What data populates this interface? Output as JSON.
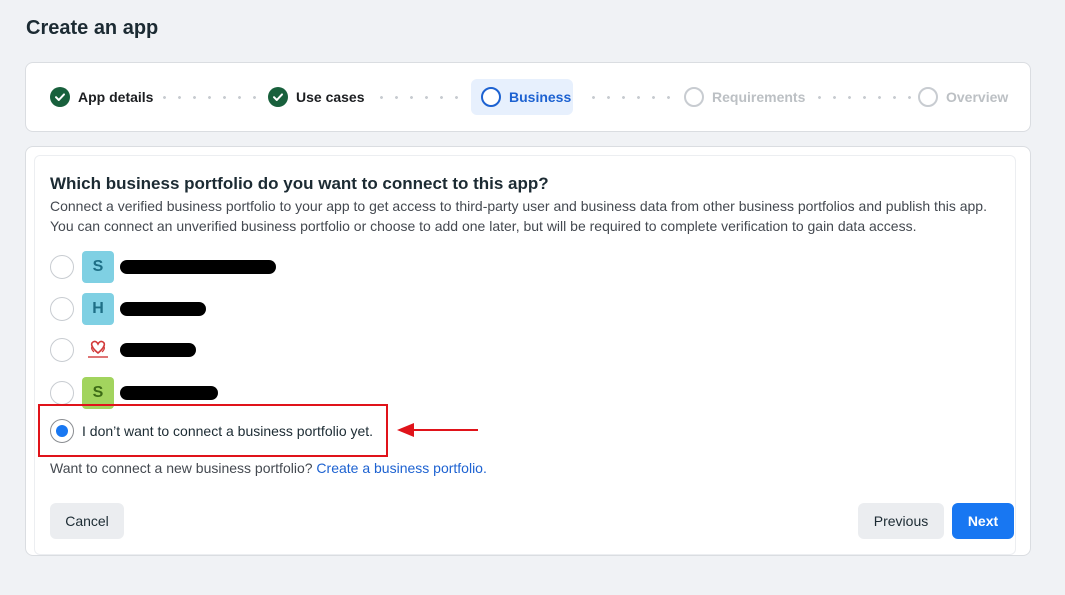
{
  "page": {
    "title": "Create an app"
  },
  "stepper": {
    "steps": [
      {
        "label": "App details",
        "state": "done"
      },
      {
        "label": "Use cases",
        "state": "done"
      },
      {
        "label": "Business",
        "state": "current"
      },
      {
        "label": "Requirements",
        "state": "pending"
      },
      {
        "label": "Overview",
        "state": "pending"
      }
    ]
  },
  "business": {
    "question": "Which business portfolio do you want to connect to this app?",
    "description": "Connect a verified business portfolio to your app to get access to third-party user and business data from other business portfolios and publish this app. You can connect an unverified business portfolio or choose to add one later, but will be required to complete verification to gain data access.",
    "options": [
      {
        "avatar_letter": "S",
        "avatar_color": "#7fd0e3",
        "selected": false
      },
      {
        "avatar_letter": "H",
        "avatar_color": "#7fd0e3",
        "selected": false
      },
      {
        "avatar_letter": "",
        "avatar_icon": "heart-logo",
        "selected": false
      },
      {
        "avatar_letter": "S",
        "avatar_color": "#a2d45e",
        "selected": false
      }
    ],
    "no_portfolio_label": "I don’t want to connect a business portfolio yet.",
    "no_portfolio_selected": true,
    "new_portfolio_prompt": "Want to connect a new business portfolio?",
    "new_portfolio_link": "Create a business portfolio."
  },
  "buttons": {
    "cancel": "Cancel",
    "previous": "Previous",
    "next": "Next"
  },
  "colors": {
    "accent": "#1877f2",
    "done": "#18603c",
    "highlight": "#e0131a"
  }
}
